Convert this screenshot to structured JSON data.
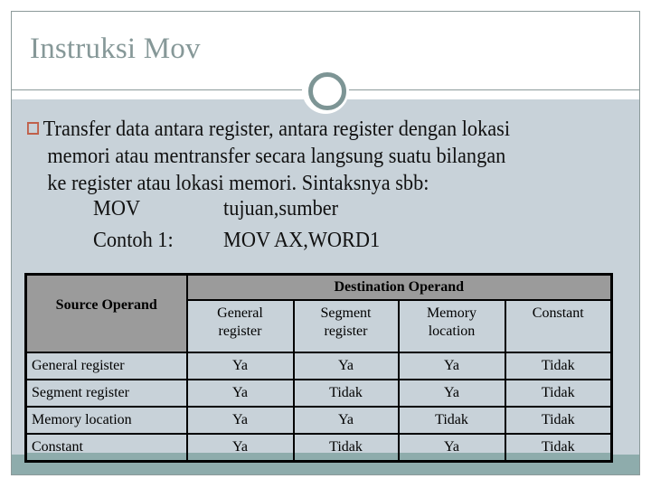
{
  "slide": {
    "title": "Instruksi Mov",
    "bullet_icon": "hollow-square-bullet-icon",
    "paragraph_lines": [
      "Transfer data antara register, antara register dengan lokasi",
      "memori atau mentransfer secara langsung suatu bilangan",
      "ke register atau lokasi memori. Sintaksnya sbb:"
    ],
    "syntax": {
      "label": "MOV",
      "value": "tujuan,sumber"
    },
    "example": {
      "label": "Contoh 1:",
      "value": "MOV AX,WORD1"
    },
    "colors": {
      "title": "#869898",
      "content_background": "#c8d2d9",
      "footer_band": "#8eacac",
      "bullet": "#c0604a",
      "table_header": "#9b9b9b"
    }
  },
  "table": {
    "source_header": "Source Operand",
    "destination_header": "Destination Operand",
    "columns": [
      {
        "line1": "General",
        "line2": "register"
      },
      {
        "line1": "Segment",
        "line2": "register"
      },
      {
        "line1": "Memory",
        "line2": "location"
      },
      {
        "line1": "Constant",
        "line2": ""
      }
    ],
    "rows": [
      {
        "source": "General register",
        "values": [
          "Ya",
          "Ya",
          "Ya",
          "Tidak"
        ]
      },
      {
        "source": "Segment register",
        "values": [
          "Ya",
          "Tidak",
          "Ya",
          "Tidak"
        ]
      },
      {
        "source": "Memory location",
        "values": [
          "Ya",
          "Ya",
          "Tidak",
          "Tidak"
        ]
      },
      {
        "source": "Constant",
        "values": [
          "Ya",
          "Tidak",
          "Ya",
          "Tidak"
        ]
      }
    ]
  }
}
